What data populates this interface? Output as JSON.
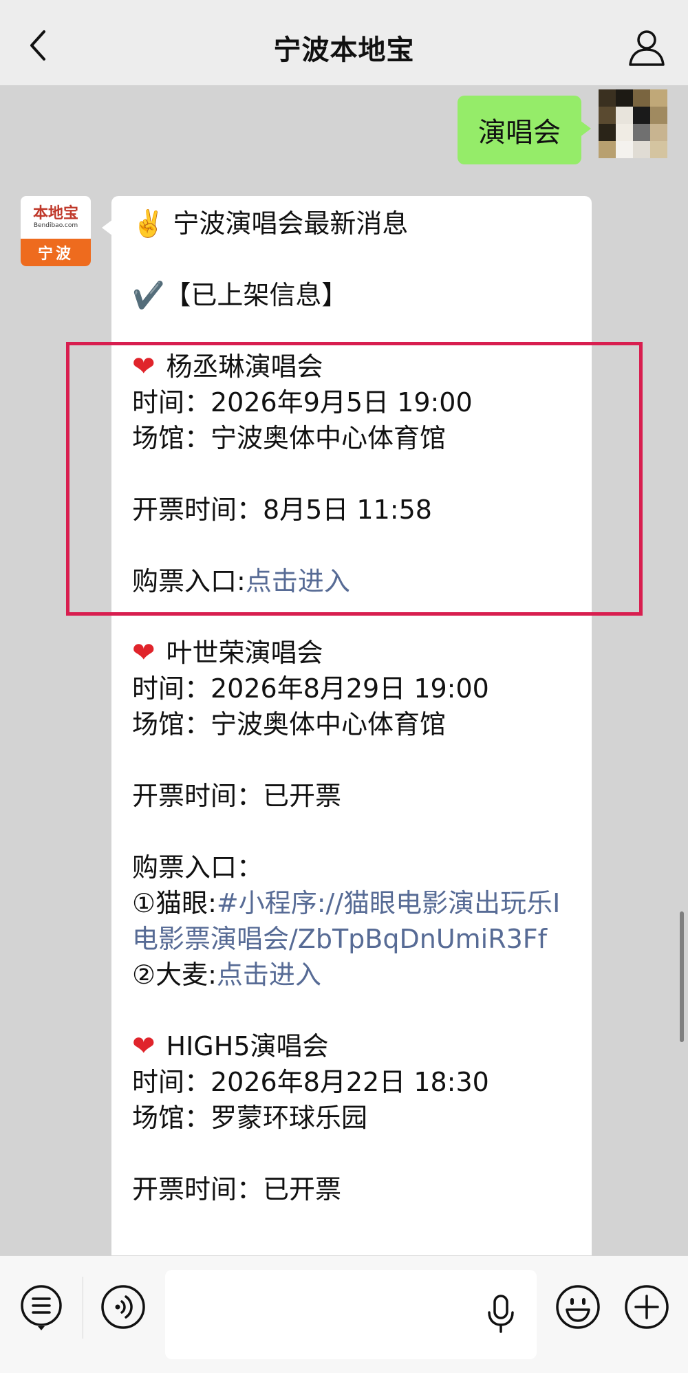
{
  "header": {
    "back_icon": "back-chevron-icon",
    "title": "宁波本地宝",
    "profile_icon": "person-icon"
  },
  "user_message": {
    "text": "演唱会"
  },
  "bot": {
    "avatar": {
      "brand": "本地宝",
      "url": "Bendibao.com",
      "city": "宁波"
    },
    "intro": "✌️ 宁波演唱会最新消息",
    "status": "✔️【已上架信息】",
    "concerts": [
      {
        "name": "杨丞琳演唱会",
        "time": "时间：2026年9月5日 19:00",
        "venue": "场馆：宁波奥体中心体育馆",
        "sale": "开票时间：8月5日 11:58",
        "buy_label": "购票入口:",
        "buy_link": "点击进入"
      },
      {
        "name": "叶世荣演唱会",
        "time": "时间：2026年8月29日 19:00",
        "venue": "场馆：宁波奥体中心体育馆",
        "sale": "开票时间：已开票",
        "buy_label": "购票入口：",
        "opt1_label": "①猫眼:",
        "opt1_link": "#小程序://猫眼电影演出玩乐I电影票演唱会/ZbTpBqDnUmiR3Ff",
        "opt2_label": "②大麦:",
        "opt2_link": "点击进入"
      },
      {
        "name": "HIGH5演唱会",
        "time": "时间：2026年8月22日 18:30",
        "venue": "场馆：罗蒙环球乐园",
        "sale": "开票时间：已开票"
      }
    ]
  },
  "input_bar": {
    "list_icon": "menu-list-icon",
    "voice_icon": "voice-icon",
    "mic_icon": "microphone-icon",
    "emoji_icon": "emoji-icon",
    "plus_icon": "plus-icon"
  },
  "colors": {
    "highlight": "#d81e4f",
    "link": "#576b95",
    "user_bubble": "#95ec69"
  }
}
